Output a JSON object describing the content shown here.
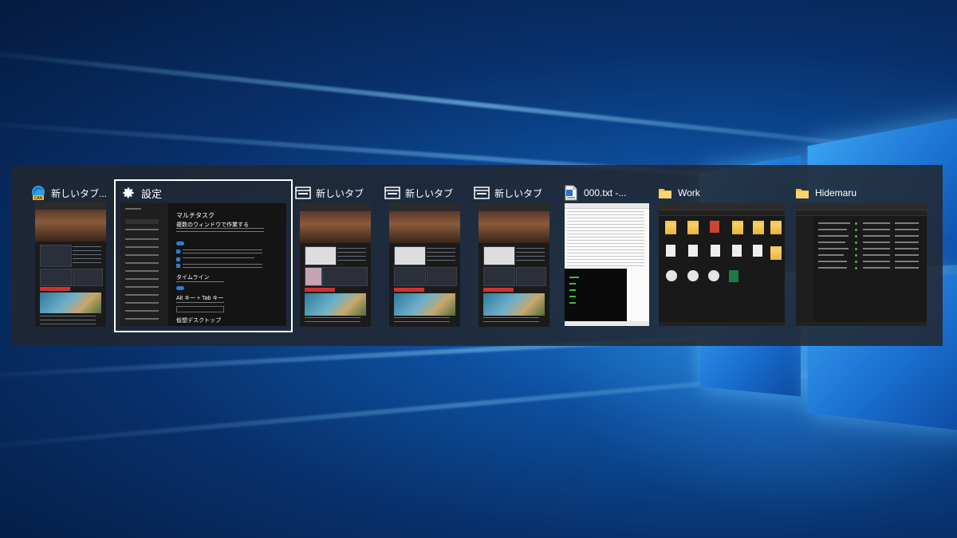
{
  "task_switcher": {
    "windows": [
      {
        "title": "新しいタブ...",
        "app": "Microsoft Edge Canary",
        "icon": "edge-canary-icon",
        "badge": "CAN"
      },
      {
        "title": "設定",
        "app": "Settings",
        "icon": "gear-icon",
        "selected": true
      },
      {
        "title": "新しいタブ",
        "app": "Browser tab",
        "icon": "tab-window-icon"
      },
      {
        "title": "新しいタブ",
        "app": "Browser tab",
        "icon": "tab-window-icon"
      },
      {
        "title": "新しいタブ",
        "app": "Browser tab",
        "icon": "tab-window-icon"
      },
      {
        "title": "000.txt  -...",
        "app": "Notepad",
        "icon": "text-file-icon"
      },
      {
        "title": "Work",
        "app": "File Explorer",
        "icon": "folder-icon"
      },
      {
        "title": "Hidemaru",
        "app": "File Explorer",
        "icon": "folder-icon"
      }
    ]
  },
  "settings_preview": {
    "page_heading": "マルチタスク",
    "section_1": "複数のウィンドウで作業する",
    "section_2": "タイムライン",
    "section_3": "Alt キー + Tab キー",
    "section_4": "仮想デスクトップ"
  },
  "colors": {
    "selected_outline": "#ffffff",
    "switcher_bg": "#22262e",
    "accent": "#2b7fd8"
  }
}
